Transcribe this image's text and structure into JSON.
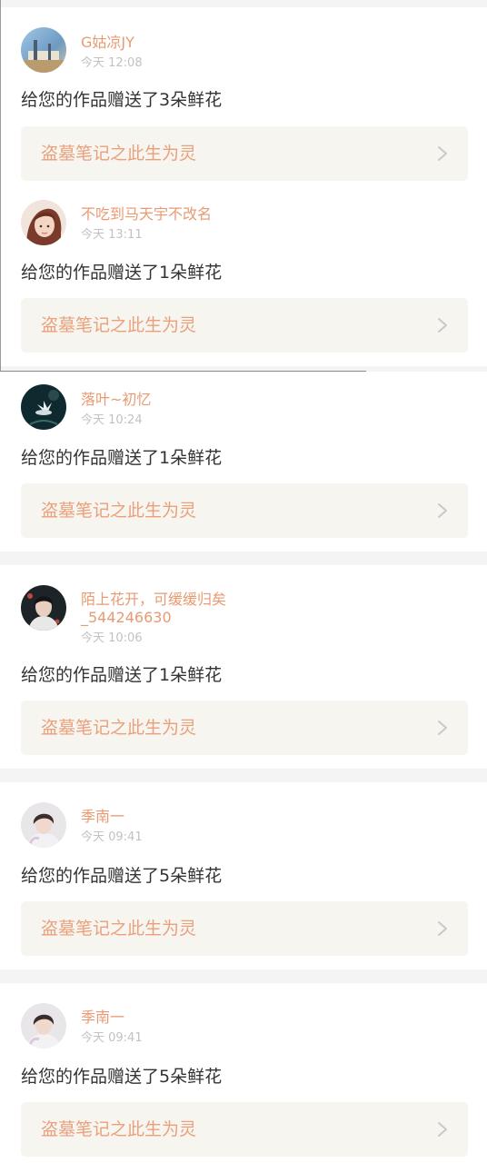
{
  "notifications": [
    {
      "username": "G姑凉JY",
      "time": "今天 12:08",
      "message": "给您的作品赠送了3朵鲜花",
      "work_title": "盗墓笔记之此生为灵"
    },
    {
      "username": "不吃到马天宇不改名",
      "time": "今天 13:11",
      "message": "给您的作品赠送了1朵鲜花",
      "work_title": "盗墓笔记之此生为灵"
    },
    {
      "username": "落叶~初忆",
      "time": "今天 10:24",
      "message": "给您的作品赠送了1朵鲜花",
      "work_title": "盗墓笔记之此生为灵"
    },
    {
      "username": "陌上花开，可缓缓归矣",
      "username_line2": "_544246630",
      "time": "今天 10:06",
      "message": "给您的作品赠送了1朵鲜花",
      "work_title": "盗墓笔记之此生为灵"
    },
    {
      "username": "季南一",
      "time": "今天 09:41",
      "message": "给您的作品赠送了5朵鲜花",
      "work_title": "盗墓笔记之此生为灵"
    },
    {
      "username": "季南一",
      "time": "今天 09:41",
      "message": "给您的作品赠送了5朵鲜花",
      "work_title": "盗墓笔记之此生为灵"
    }
  ],
  "icons": {
    "chevron": "chevron-right-icon",
    "avatar": "user-avatar"
  },
  "colors": {
    "username": "#e89a72",
    "time": "#c2c2c2",
    "message": "#333333",
    "link_text": "#eba07c",
    "link_bg": "#f6f5ef",
    "page_bg": "#f4f4f4"
  }
}
